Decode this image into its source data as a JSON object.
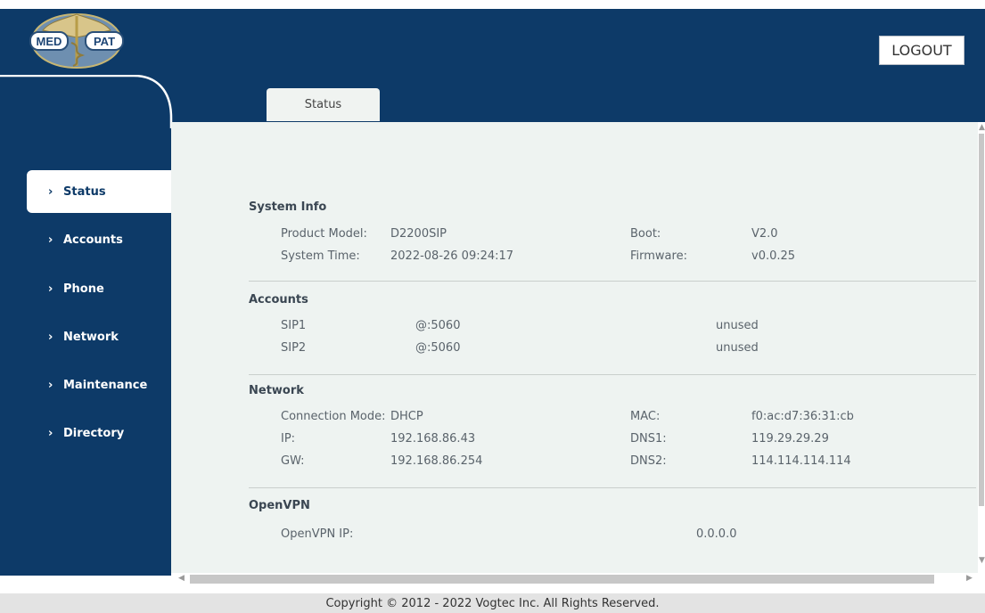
{
  "header": {
    "logo_text_left": "MED",
    "logo_text_right": "PAT",
    "logout_label": "LOGOUT"
  },
  "tabs": [
    {
      "label": "Status"
    }
  ],
  "sidebar": {
    "items": [
      {
        "label": "Status",
        "active": true
      },
      {
        "label": "Accounts"
      },
      {
        "label": "Phone"
      },
      {
        "label": "Network"
      },
      {
        "label": "Maintenance"
      },
      {
        "label": "Directory"
      }
    ]
  },
  "system_info": {
    "title": "System Info",
    "product_model_label": "Product Model:",
    "product_model": "D2200SIP",
    "system_time_label": "System Time:",
    "system_time": "2022-08-26 09:24:17",
    "boot_label": "Boot:",
    "boot": "V2.0",
    "firmware_label": "Firmware:",
    "firmware": "v0.0.25"
  },
  "accounts": {
    "title": "Accounts",
    "rows": [
      {
        "name": "SIP1",
        "address": "@:5060",
        "status": "unused"
      },
      {
        "name": "SIP2",
        "address": "@:5060",
        "status": "unused"
      }
    ]
  },
  "network": {
    "title": "Network",
    "connection_mode_label": "Connection Mode:",
    "connection_mode": "DHCP",
    "ip_label": "IP:",
    "ip": "192.168.86.43",
    "gw_label": "GW:",
    "gw": "192.168.86.254",
    "mac_label": "MAC:",
    "mac": "f0:ac:d7:36:31:cb",
    "dns1_label": "DNS1:",
    "dns1": "119.29.29.29",
    "dns2_label": "DNS2:",
    "dns2": "114.114.114.114"
  },
  "openvpn": {
    "title": "OpenVPN",
    "ip_label": "OpenVPN IP:",
    "ip": "0.0.0.0"
  },
  "footer": {
    "copyright": "Copyright © 2012 - 2022 Vogtec Inc. All Rights Reserved."
  },
  "icons": {
    "nav_arrow": "chevron-right-icon",
    "logo": "caduceus-logo"
  },
  "colors": {
    "navy": "#0d3a68",
    "content_bg": "#eef3f1",
    "footer_bg": "#e3e3e3"
  }
}
